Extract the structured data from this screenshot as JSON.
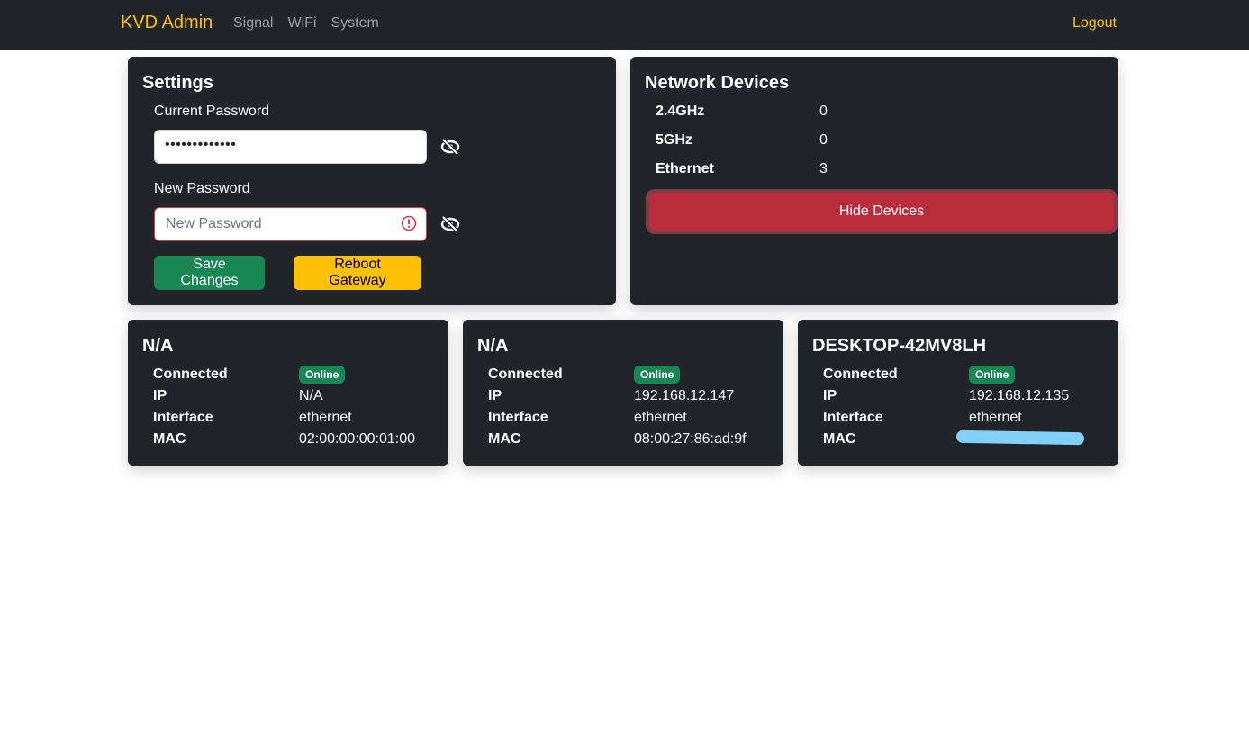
{
  "nav": {
    "brand": "KVD Admin",
    "links": [
      "Signal",
      "WiFi",
      "System"
    ],
    "logout": "Logout",
    "accent_color": "#ffc107"
  },
  "settings": {
    "title": "Settings",
    "current_password_label": "Current Password",
    "current_password_value": "•••••••••••••",
    "new_password_label": "New Password",
    "new_password_placeholder": "New Password",
    "new_password_value": "",
    "save_label": "Save Changes",
    "reboot_label": "Reboot Gateway"
  },
  "network": {
    "title": "Network Devices",
    "stats": [
      {
        "label": "2.4GHz",
        "value": "0"
      },
      {
        "label": "5GHz",
        "value": "0"
      },
      {
        "label": "Ethernet",
        "value": "3"
      }
    ],
    "hide_label": "Hide Devices"
  },
  "devices": [
    {
      "name": "N/A",
      "fields": {
        "connected_label": "Connected",
        "connected": "Online",
        "ip_label": "IP",
        "ip": "N/A",
        "interface_label": "Interface",
        "interface": "ethernet",
        "mac_label": "MAC",
        "mac": "02:00:00:00:01:00"
      }
    },
    {
      "name": "N/A",
      "fields": {
        "connected_label": "Connected",
        "connected": "Online",
        "ip_label": "IP",
        "ip": "192.168.12.147",
        "interface_label": "Interface",
        "interface": "ethernet",
        "mac_label": "MAC",
        "mac": "08:00:27:86:ad:9f"
      }
    },
    {
      "name": "DESKTOP-42MV8LH",
      "fields": {
        "connected_label": "Connected",
        "connected": "Online",
        "ip_label": "IP",
        "ip": "192.168.12.135",
        "interface_label": "Interface",
        "interface": "ethernet",
        "mac_label": "MAC",
        "mac": ""
      }
    }
  ]
}
